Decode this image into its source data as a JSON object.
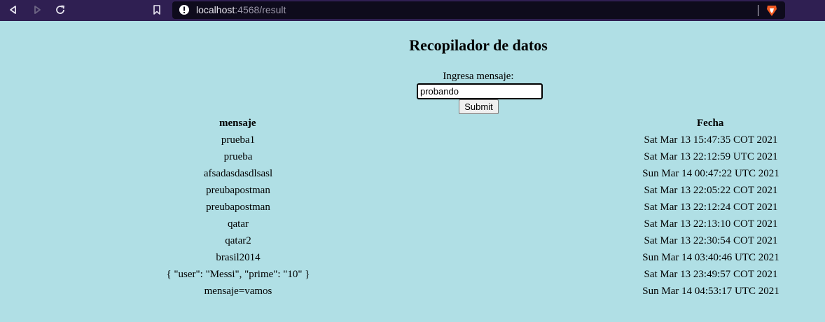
{
  "browser": {
    "url_host": "localhost",
    "url_rest": ":4568/result"
  },
  "page": {
    "title": "Recopilador de datos",
    "form_label": "Ingresa mensaje:",
    "input_value": "probando",
    "submit_label": "Submit"
  },
  "table": {
    "headers": {
      "message": "mensaje",
      "date": "Fecha"
    },
    "rows": [
      {
        "message": "prueba1",
        "date": "Sat Mar 13 15:47:35 COT 2021"
      },
      {
        "message": "prueba",
        "date": "Sat Mar 13 22:12:59 UTC 2021"
      },
      {
        "message": "afsadasdasdlsasl",
        "date": "Sun Mar 14 00:47:22 UTC 2021"
      },
      {
        "message": "preubapostman",
        "date": "Sat Mar 13 22:05:22 COT 2021"
      },
      {
        "message": "preubapostman",
        "date": "Sat Mar 13 22:12:24 COT 2021"
      },
      {
        "message": "qatar",
        "date": "Sat Mar 13 22:13:10 COT 2021"
      },
      {
        "message": "qatar2",
        "date": "Sat Mar 13 22:30:54 COT 2021"
      },
      {
        "message": "brasil2014",
        "date": "Sun Mar 14 03:40:46 UTC 2021"
      },
      {
        "message": "{ \"user\": \"Messi\", \"prime\": \"10\" }",
        "date": "Sat Mar 13 23:49:57 COT 2021"
      },
      {
        "message": "mensaje=vamos",
        "date": "Sun Mar 14 04:53:17 UTC 2021"
      }
    ]
  }
}
